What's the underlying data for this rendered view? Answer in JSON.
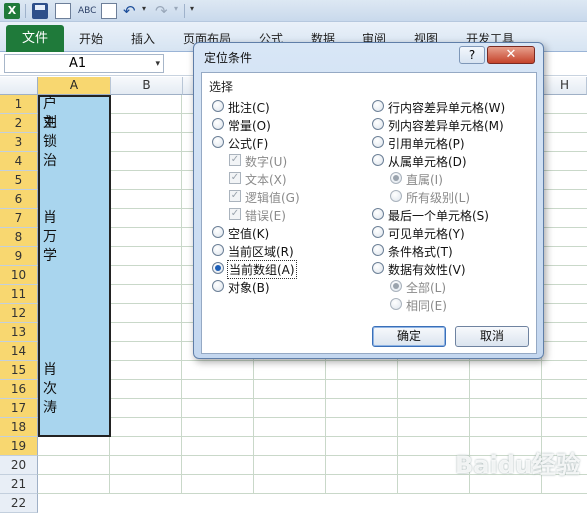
{
  "app": {
    "logo_text": "X",
    "qat": {
      "dropdown_glyph": "▾",
      "more_glyph": "▾"
    }
  },
  "ribbon": {
    "file_tab": "文件",
    "tabs": [
      "开始",
      "插入",
      "页面布局",
      "公式",
      "数据",
      "审阅",
      "视图",
      "开发工具"
    ]
  },
  "formula_bar": {
    "name_box": "A1",
    "dropdown_glyph": "▾"
  },
  "sheet": {
    "columns": [
      "A",
      "B",
      "H"
    ],
    "rows": [
      "1",
      "2",
      "3",
      "4",
      "5",
      "6",
      "7",
      "8",
      "9",
      "10",
      "11",
      "12",
      "13",
      "14",
      "15",
      "16",
      "17",
      "18",
      "19",
      "20",
      "21",
      "22"
    ],
    "cells": {
      "A1": "户主",
      "A2": "刘锁治",
      "A7": "肖万学",
      "A15": "肖次涛"
    },
    "selection_color": "#a9d5ee"
  },
  "dialog": {
    "title": "定位条件",
    "help_label": "?",
    "close_label": "✕",
    "group_label": "选择",
    "left_options": [
      {
        "label": "批注(C)"
      },
      {
        "label": "常量(O)"
      },
      {
        "label": "公式(F)"
      },
      {
        "label": "数字(U)"
      },
      {
        "label": "文本(X)"
      },
      {
        "label": "逻辑值(G)"
      },
      {
        "label": "错误(E)"
      },
      {
        "label": "空值(K)"
      },
      {
        "label": "当前区域(R)"
      },
      {
        "label": "当前数组(A)"
      },
      {
        "label": "对象(B)"
      }
    ],
    "right_options": [
      {
        "label": "行内容差异单元格(W)"
      },
      {
        "label": "列内容差异单元格(M)"
      },
      {
        "label": "引用单元格(P)"
      },
      {
        "label": "从属单元格(D)"
      },
      {
        "label": "直属(I)"
      },
      {
        "label": "所有级别(L)"
      },
      {
        "label": "最后一个单元格(S)"
      },
      {
        "label": "可见单元格(Y)"
      },
      {
        "label": "条件格式(T)"
      },
      {
        "label": "数据有效性(V)"
      },
      {
        "label": "全部(L)"
      },
      {
        "label": "相同(E)"
      }
    ],
    "selected_option": "当前数组(A)",
    "ok_label": "确定",
    "cancel_label": "取消"
  },
  "watermark": "Baidu经验",
  "colors": {
    "excel_green": "#1f7a3a",
    "selection": "#a9d5ee",
    "dialog_frame": "#5f7ea8",
    "close_red": "#c5432b"
  }
}
